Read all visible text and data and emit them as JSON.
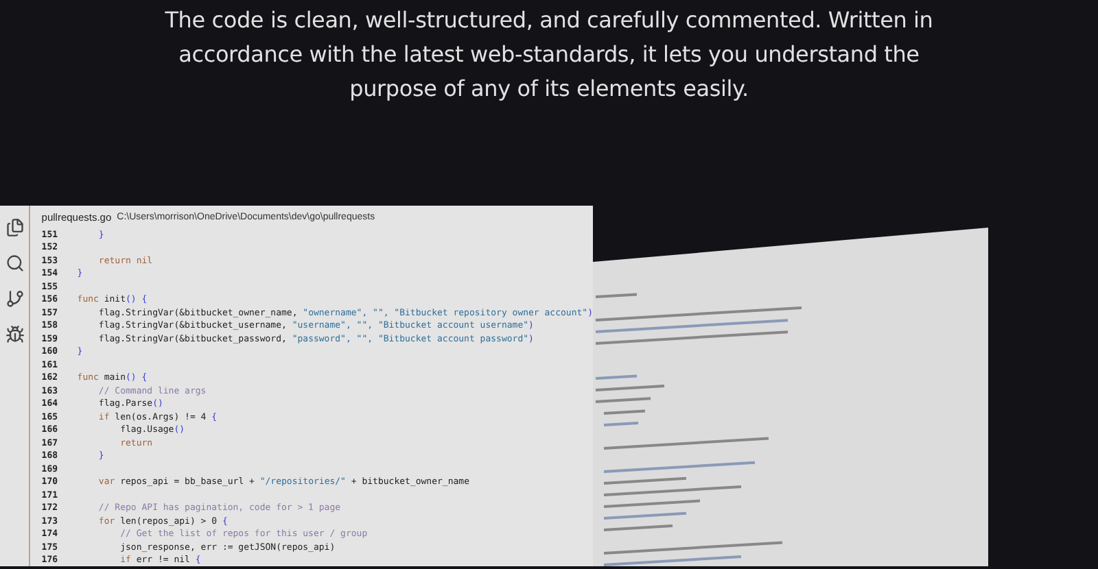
{
  "intro": {
    "lines": [
      "The code is clean, well-structured, and carefully commented. Written in",
      "accordance with the latest web-standards, it lets you understand the",
      "purpose of any of its elements easily."
    ]
  },
  "editor": {
    "file_name": "pullrequests.go",
    "file_path": "C:\\Users\\morrison\\OneDrive\\Documents\\dev\\go\\pullrequests",
    "lines": [
      {
        "number": "151",
        "tokens": [
          {
            "kind": "punct",
            "text": "    }"
          }
        ]
      },
      {
        "number": "152"
      },
      {
        "number": "153",
        "tokens": [
          {
            "kind": "kw",
            "text": "    return nil"
          }
        ]
      },
      {
        "number": "154",
        "tokens": [
          {
            "kind": "punct",
            "text": "}"
          }
        ]
      },
      {
        "number": "155"
      },
      {
        "number": "156",
        "tokens": [
          {
            "kind": "kw",
            "text": "func"
          },
          {
            "kind": "plain",
            "text": " init"
          },
          {
            "kind": "punct",
            "text": "() {"
          }
        ]
      },
      {
        "number": "157",
        "tokens": [
          {
            "kind": "plain",
            "text": "    flag.StringVar(&bitbucket_owner_name, "
          },
          {
            "kind": "str",
            "text": "\"ownername\", \"\", \"Bitbucket repository owner account\""
          },
          {
            "kind": "punct",
            "text": ")"
          }
        ]
      },
      {
        "number": "158",
        "tokens": [
          {
            "kind": "plain",
            "text": "    flag.StringVar(&bitbucket_username, "
          },
          {
            "kind": "str",
            "text": "\"username\", \"\", \"Bitbucket account username\""
          },
          {
            "kind": "punct",
            "text": ")"
          }
        ]
      },
      {
        "number": "159",
        "tokens": [
          {
            "kind": "plain",
            "text": "    flag.StringVar(&bitbucket_password, "
          },
          {
            "kind": "str",
            "text": "\"password\", \"\", \"Bitbucket account password\""
          },
          {
            "kind": "punct",
            "text": ")"
          }
        ]
      },
      {
        "number": "160",
        "tokens": [
          {
            "kind": "punct",
            "text": "}"
          }
        ]
      },
      {
        "number": "161"
      },
      {
        "number": "162",
        "tokens": [
          {
            "kind": "kw",
            "text": "func"
          },
          {
            "kind": "plain",
            "text": " main"
          },
          {
            "kind": "punct",
            "text": "() {"
          }
        ]
      },
      {
        "number": "163",
        "tokens": [
          {
            "kind": "com",
            "text": "    // Command line args"
          }
        ]
      },
      {
        "number": "164",
        "tokens": [
          {
            "kind": "plain",
            "text": "    flag.Parse"
          },
          {
            "kind": "punct",
            "text": "()"
          }
        ]
      },
      {
        "number": "165",
        "tokens": [
          {
            "kind": "kw",
            "text": "    if"
          },
          {
            "kind": "plain",
            "text": " len(os.Args) != 4 "
          },
          {
            "kind": "punct",
            "text": "{"
          }
        ]
      },
      {
        "number": "166",
        "tokens": [
          {
            "kind": "plain",
            "text": "        flag.Usage"
          },
          {
            "kind": "punct",
            "text": "()"
          }
        ]
      },
      {
        "number": "167",
        "tokens": [
          {
            "kind": "kw",
            "text": "        return"
          }
        ]
      },
      {
        "number": "168",
        "tokens": [
          {
            "kind": "punct",
            "text": "    }"
          }
        ]
      },
      {
        "number": "169"
      },
      {
        "number": "170",
        "tokens": [
          {
            "kind": "kw",
            "text": "    var"
          },
          {
            "kind": "plain",
            "text": " repos_api = bb_base_url + "
          },
          {
            "kind": "str",
            "text": "\"/repositories/\""
          },
          {
            "kind": "plain",
            "text": " + bitbucket_owner_name"
          }
        ]
      },
      {
        "number": "171"
      },
      {
        "number": "172",
        "tokens": [
          {
            "kind": "com",
            "text": "    // Repo API has pagination, code for > 1 page"
          }
        ]
      },
      {
        "number": "173",
        "tokens": [
          {
            "kind": "kw",
            "text": "    for"
          },
          {
            "kind": "plain",
            "text": " len(repos_api) > 0 "
          },
          {
            "kind": "punct",
            "text": "{"
          }
        ]
      },
      {
        "number": "174",
        "tokens": [
          {
            "kind": "com",
            "text": "        // Get the list of repos for this user / group"
          }
        ]
      },
      {
        "number": "175",
        "tokens": [
          {
            "kind": "plain",
            "text": "        json_response, err := getJSON(repos_api)"
          }
        ]
      },
      {
        "number": "176",
        "tokens": [
          {
            "kind": "kw",
            "text": "        if"
          },
          {
            "kind": "plain",
            "text": " err != nil "
          },
          {
            "kind": "punct",
            "text": "{"
          }
        ]
      }
    ]
  }
}
